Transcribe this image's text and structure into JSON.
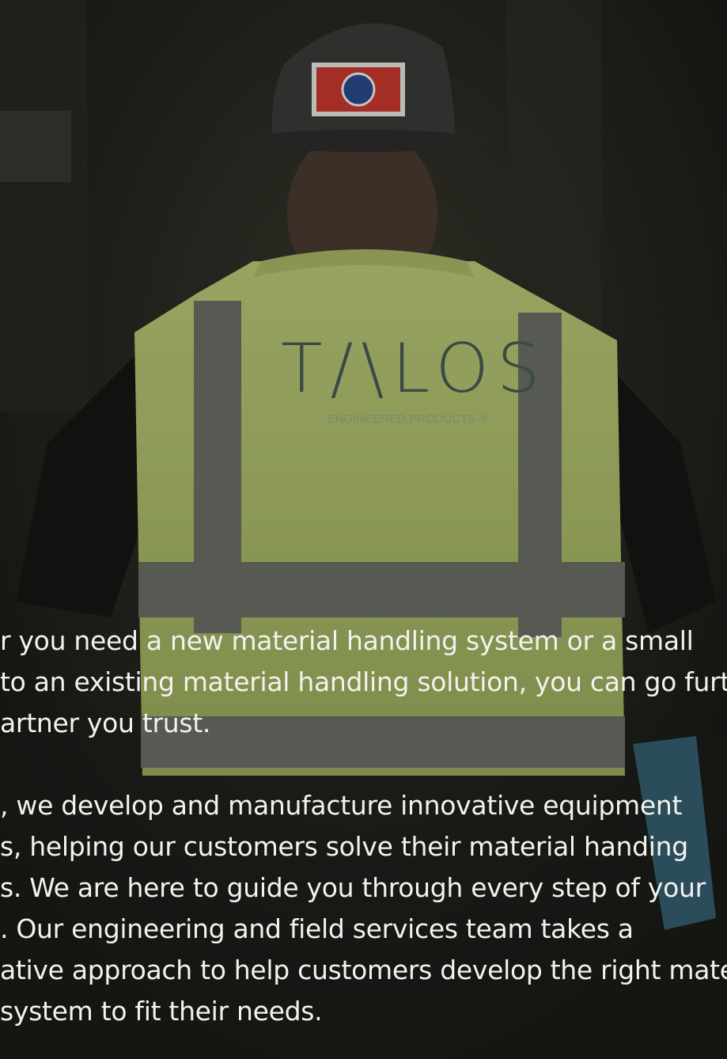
{
  "scene": {
    "description_icon": "construction-worker-back-view",
    "colors": {
      "vest": "#c8d87a",
      "stripe": "#6a6e64",
      "helmet": "#3a3a38",
      "flag": "#c8382e",
      "text": "#f2f2ee"
    }
  },
  "vest_logo": {
    "wordmark": "T/\\LOS",
    "tagline": "ENGINEERED PRODUCTS ®"
  },
  "copy": {
    "paragraph_1": [
      "r you need a new material handling system or a small",
      " to an existing material handling solution, you can go furth",
      "artner you trust."
    ],
    "paragraph_2": [
      ", we develop and manufacture innovative equipment",
      "s, helping our customers solve their material handing",
      "s. We are here to guide you through every step of your",
      ". Our engineering and field services team takes a",
      "ative approach to help customers develop the right materi",
      " system to fit their needs."
    ]
  }
}
